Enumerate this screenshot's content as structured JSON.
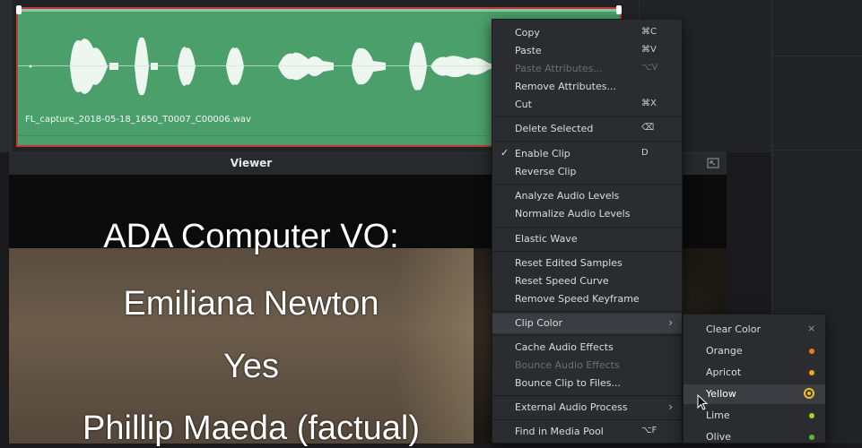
{
  "clip": {
    "filename": "FL_capture_2018-05-18_1650_T0007_C00006.wav",
    "color": "#4a9f6a"
  },
  "viewer": {
    "title": "Viewer",
    "subtitle_lines": [
      "ADA Computer VO:",
      "Emiliana Newton",
      "Yes",
      "Phillip Maeda (factual)"
    ]
  },
  "menu": {
    "items": [
      {
        "label": "Copy",
        "shortcut": "⌘C",
        "enabled": true
      },
      {
        "label": "Paste",
        "shortcut": "⌘V",
        "enabled": true
      },
      {
        "label": "Paste Attributes...",
        "shortcut": "⌥V",
        "enabled": false
      },
      {
        "label": "Remove Attributes...",
        "shortcut": "",
        "enabled": true
      },
      {
        "label": "Cut",
        "shortcut": "⌘X",
        "enabled": true
      },
      {
        "label": "Delete Selected",
        "shortcut": "⌫",
        "enabled": true
      },
      {
        "label": "Enable Clip",
        "shortcut": "D",
        "enabled": true,
        "checked": true
      },
      {
        "label": "Reverse Clip",
        "shortcut": "",
        "enabled": true
      },
      {
        "label": "Analyze Audio Levels",
        "shortcut": "",
        "enabled": true
      },
      {
        "label": "Normalize Audio Levels",
        "shortcut": "",
        "enabled": true
      },
      {
        "label": "Elastic Wave",
        "shortcut": "",
        "enabled": true
      },
      {
        "label": "Reset Edited Samples",
        "shortcut": "",
        "enabled": true
      },
      {
        "label": "Reset Speed Curve",
        "shortcut": "",
        "enabled": true
      },
      {
        "label": "Remove Speed Keyframe",
        "shortcut": "",
        "enabled": true
      },
      {
        "label": "Clip Color",
        "shortcut": "",
        "enabled": true,
        "submenu": true
      },
      {
        "label": "Cache Audio Effects",
        "shortcut": "",
        "enabled": true
      },
      {
        "label": "Bounce Audio Effects",
        "shortcut": "",
        "enabled": false
      },
      {
        "label": "Bounce Clip to Files...",
        "shortcut": "",
        "enabled": true
      },
      {
        "label": "External Audio Process",
        "shortcut": "",
        "enabled": true,
        "submenu": true
      },
      {
        "label": "Find in Media Pool",
        "shortcut": "⌥F",
        "enabled": true
      }
    ]
  },
  "clip_color_submenu": {
    "items": [
      {
        "label": "Clear Color",
        "color": "",
        "selected": false
      },
      {
        "label": "Orange",
        "color": "#f07a1e",
        "selected": false
      },
      {
        "label": "Apricot",
        "color": "#f5a21e",
        "selected": false
      },
      {
        "label": "Yellow",
        "color": "#f0c020",
        "selected": true
      },
      {
        "label": "Lime",
        "color": "#a6d22a",
        "selected": false
      },
      {
        "label": "Olive",
        "color": "#5fb82c",
        "selected": false
      }
    ]
  },
  "icons": {
    "check": "checkmark-icon",
    "submenu_arrow": "chevron-right-icon",
    "clear": "close-icon",
    "expand": "expand-icon",
    "cursor": "mouse-pointer-icon"
  }
}
